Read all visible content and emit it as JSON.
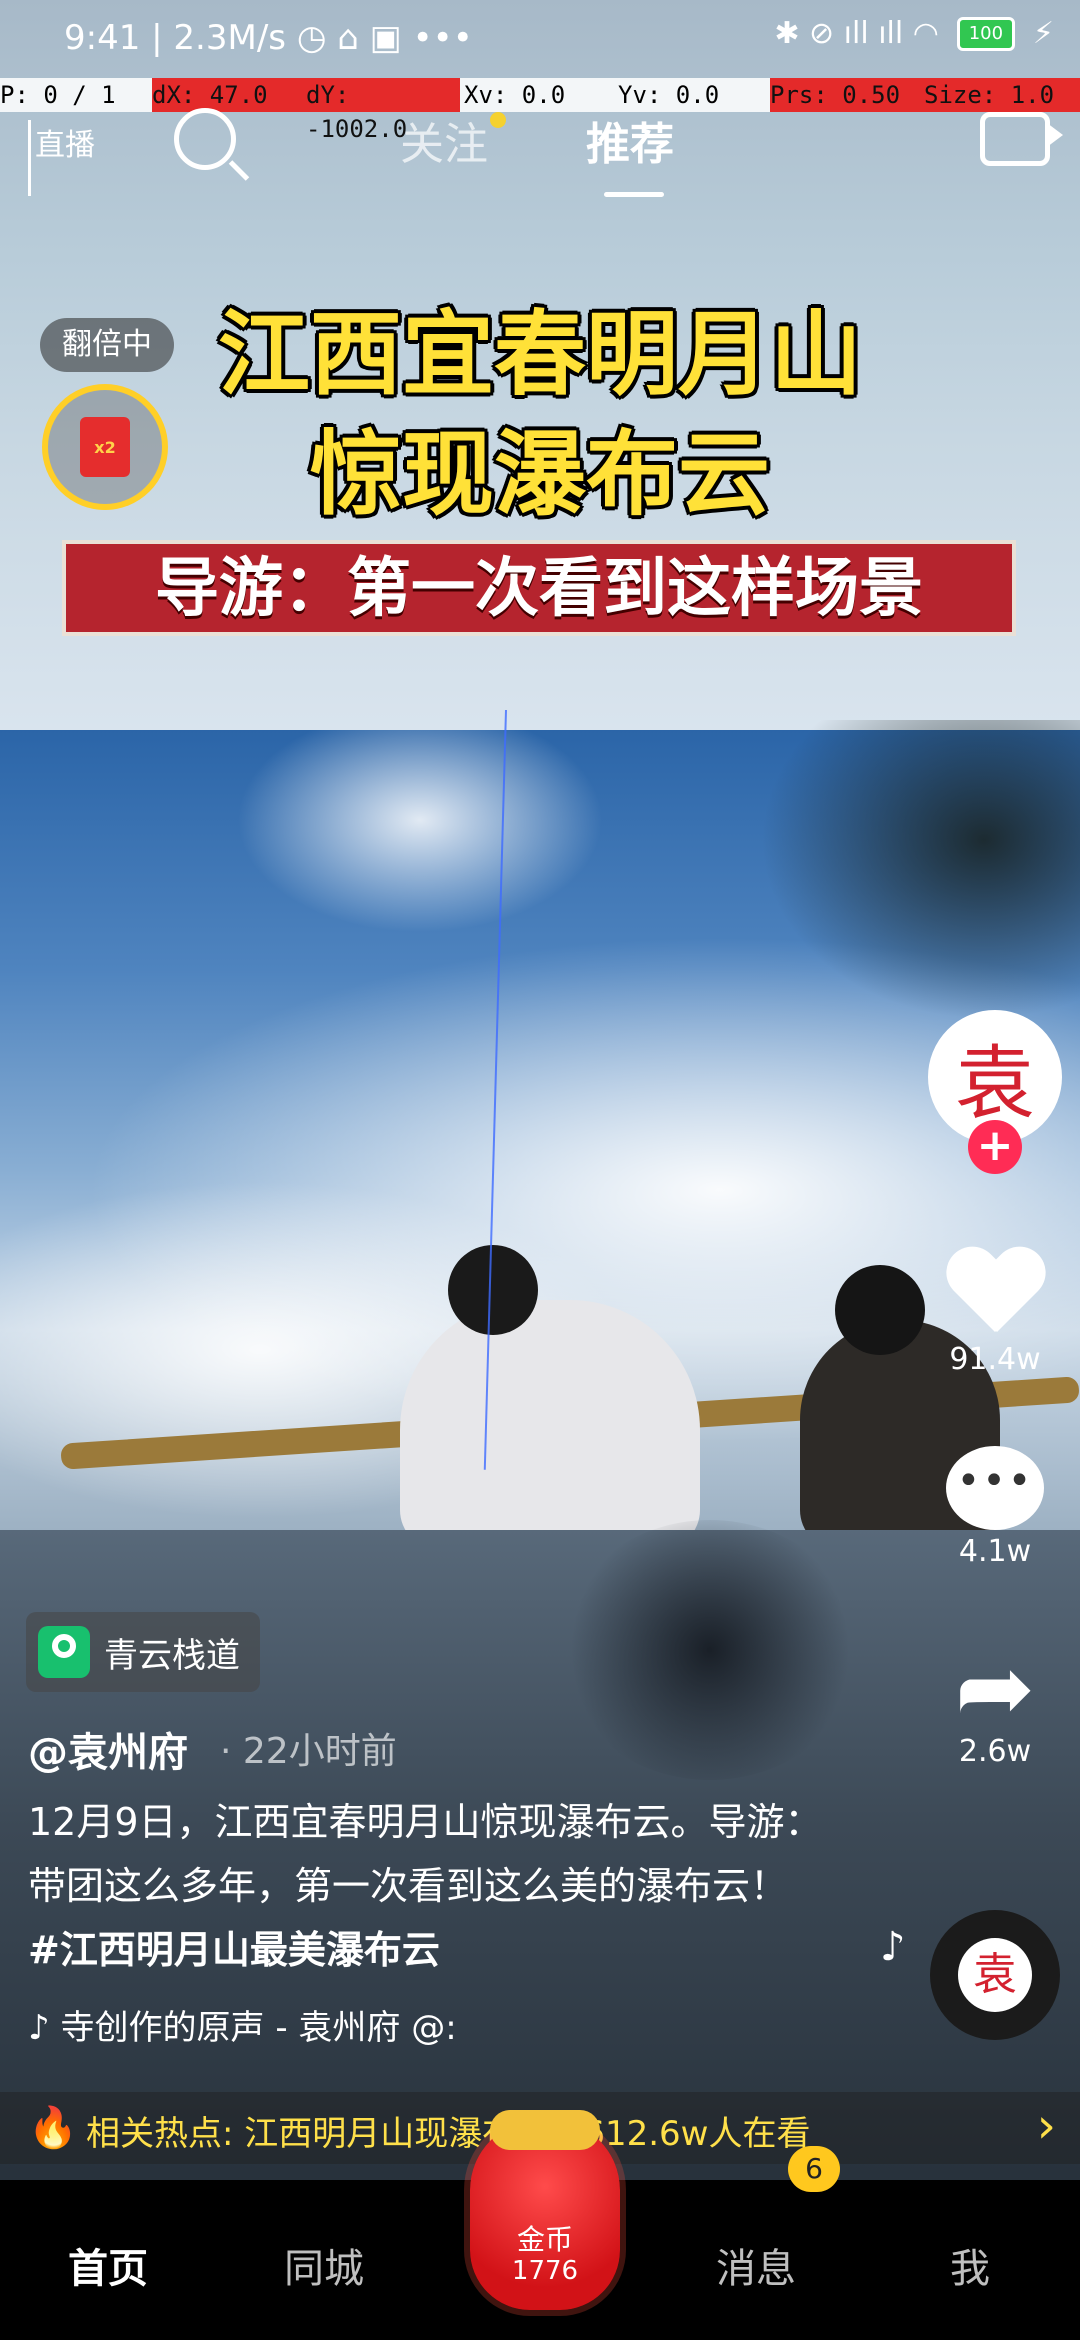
{
  "status_bar": {
    "time_speed": "9:41 | 2.3M/s",
    "extra_icons": "◷ ⌂ ▣ •••",
    "right_icons": "✱ ⊘ ıll ıll ◠",
    "battery": "100"
  },
  "debug_overlay": {
    "p": "P: 0 / 1",
    "dx": "dX: 47.0",
    "dy": "dY: -1002.0",
    "xv": "Xv: 0.0",
    "yv": "Yv: 0.0",
    "prs": "Prs: 0.50",
    "size": "Size: 1.0"
  },
  "top_nav": {
    "live": "直播",
    "follow": "关注",
    "recommend": "推荐"
  },
  "reward": {
    "double_label": "翻倍中",
    "multiplier": "x2"
  },
  "video_overlay": {
    "title_line1": "江西宜春明月山",
    "title_line2": "惊现瀑布云",
    "subtitle": "导游：第一次看到这样场景"
  },
  "actions": {
    "avatar_char": "袁",
    "follow_plus": "+",
    "likes": "91.4w",
    "comments": "4.1w",
    "shares": "2.6w",
    "comment_dots": "•••",
    "share_glyph": "➦"
  },
  "info": {
    "location": "青云栈道",
    "author": "@袁州府",
    "time": "· 22小时前",
    "caption": "12月9日，江西宜春明月山惊现瀑布云。导游：带团这么多年，第一次看到这么美的瀑布云！",
    "hashtag": "#江西明月山最美瀑布云",
    "music": "♪ 寺创作的原声 - 袁州府   @:"
  },
  "hot": {
    "text": "相关热点: 江西明月山现瀑布云 | 612.6w人在看",
    "icon": "🔥",
    "arrow": "›"
  },
  "tab_bar": {
    "home": "首页",
    "city": "同城",
    "coin_label": "金币",
    "coin_count": "1776",
    "messages": "消息",
    "messages_badge": "6",
    "me": "我"
  }
}
